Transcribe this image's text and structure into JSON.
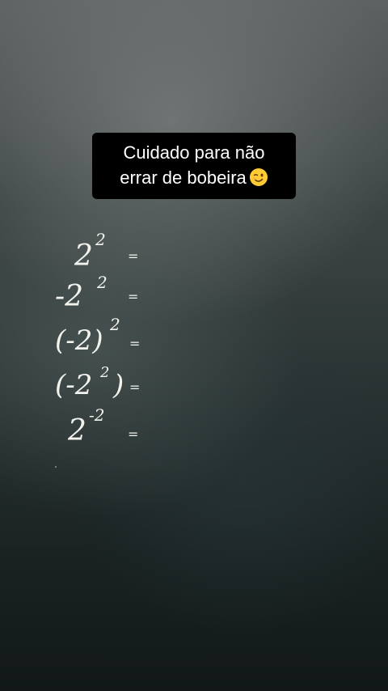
{
  "caption": {
    "line1": "Cuidado para não",
    "line2": "errar de bobeira",
    "emoji": "winking-face-emoji"
  },
  "expressions": [
    {
      "main": "2",
      "exp": "2",
      "eq": "="
    },
    {
      "main": "-2",
      "exp": "2",
      "eq": "="
    },
    {
      "main": "(-2)",
      "exp": "2",
      "eq": "="
    },
    {
      "main": "(-2",
      "exp": "2",
      "tail": ")",
      "eq": "="
    },
    {
      "main": "2",
      "exp": "-2",
      "eq": "="
    }
  ],
  "colors": {
    "chalk": "#f3f3ee",
    "caption_bg": "#000000",
    "board": "#2b3434"
  }
}
